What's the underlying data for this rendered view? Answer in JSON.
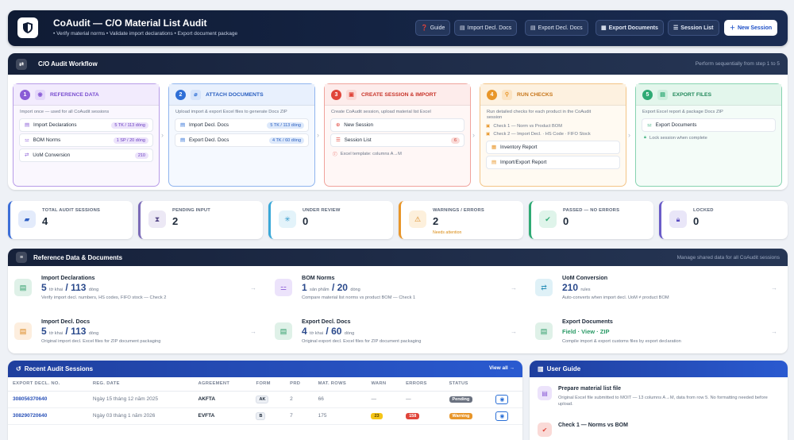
{
  "header": {
    "title": "CoAudit — C/O Material List Audit",
    "subtitle": "• Verify material norms  •  Validate import declarations  •  Export document package",
    "buttons": {
      "guide": "Guide",
      "import_docs": "Import Decl. Docs",
      "export_docs": "Export Decl. Docs",
      "export_documents": "Export Documents",
      "session_list": "Session List",
      "new_session": "New Session"
    }
  },
  "workflow": {
    "title": "C/O Audit Workflow",
    "note": "Perform sequentially from step 1 to 5",
    "steps": [
      {
        "num": "1",
        "title": "REFERENCE DATA",
        "desc": "Import once — used for all CoAudit sessions",
        "items": [
          {
            "label": "Import Declarations",
            "badge": "5 TK / 113 dòng"
          },
          {
            "label": "BOM Norms",
            "badge": "1 SP / 20 dòng"
          },
          {
            "label": "UoM Conversion",
            "badge": "210"
          }
        ]
      },
      {
        "num": "2",
        "title": "ATTACH DOCUMENTS",
        "desc": "Upload import & export Excel files to generate Docs ZIP",
        "items": [
          {
            "label": "Import Decl. Docs",
            "badge": "5 TK / 113 dòng"
          },
          {
            "label": "Export Decl. Docs",
            "badge": "4 TK / 60 dòng"
          }
        ]
      },
      {
        "num": "3",
        "title": "CREATE SESSION & IMPORT",
        "desc": "Create CoAudit session, upload material list Excel",
        "items": [
          {
            "label": "New Session",
            "badge": ""
          },
          {
            "label": "Session List",
            "badge": "6"
          }
        ],
        "note": "Excel template: columns A→M"
      },
      {
        "num": "4",
        "title": "RUN CHECKS",
        "desc": "Run detailed checks for each product in the CoAudit",
        "desc2": "session",
        "checks": [
          "Check 1 — Norm vs Product BOM",
          "Check 2 — Import Decl. · HS Code · FIFO Stock"
        ],
        "items": [
          {
            "label": "Inventory Report",
            "badge": ""
          },
          {
            "label": "Import/Export Report",
            "badge": ""
          }
        ]
      },
      {
        "num": "5",
        "title": "EXPORT FILES",
        "desc": "Export Excel report & package Docs ZIP",
        "items": [
          {
            "label": "Export Documents",
            "badge": ""
          }
        ],
        "note": "Lock session when complete"
      }
    ]
  },
  "stats": [
    {
      "label": "TOTAL AUDIT SESSIONS",
      "value": "4",
      "note": ""
    },
    {
      "label": "PENDING INPUT",
      "value": "2",
      "note": ""
    },
    {
      "label": "UNDER REVIEW",
      "value": "0",
      "note": ""
    },
    {
      "label": "WARNINGS / ERRORS",
      "value": "2",
      "note": "Needs attention"
    },
    {
      "label": "PASSED — NO ERRORS",
      "value": "0",
      "note": ""
    },
    {
      "label": "LOCKED",
      "value": "0",
      "note": ""
    }
  ],
  "reference": {
    "title": "Reference Data & Documents",
    "note": "Manage shared data for all CoAudit sessions",
    "cards": [
      {
        "title": "Import Declarations",
        "v1": "5",
        "u1": "tờ khai",
        "v2": "113",
        "u2": "dòng",
        "desc": "Verify import decl. numbers, HS codes, FIFO stock — Check 2"
      },
      {
        "title": "BOM Norms",
        "v1": "1",
        "u1": "sản phẩm",
        "v2": "20",
        "u2": "dòng",
        "desc": "Compare material list norms vs product BOM — Check 1"
      },
      {
        "title": "UoM Conversion",
        "v1": "210",
        "u1": "rules",
        "v2": "",
        "u2": "",
        "desc": "Auto-converts when import decl. UoM ≠ product BOM"
      },
      {
        "title": "Import Decl. Docs",
        "v1": "5",
        "u1": "tờ khai",
        "v2": "113",
        "u2": "dòng",
        "desc": "Original import decl. Excel files for ZIP document packaging"
      },
      {
        "title": "Export Decl. Docs",
        "v1": "4",
        "u1": "tờ khai",
        "v2": "60",
        "u2": "dòng",
        "desc": "Original export decl. Excel files for ZIP document packaging"
      },
      {
        "title": "Export Documents",
        "v1": "Field · View · ZIP",
        "u1": "",
        "v2": "",
        "u2": "",
        "desc": "Compile import & export customs files by export declaration"
      }
    ]
  },
  "sessions": {
    "title": "Recent Audit Sessions",
    "view_all": "View all →",
    "columns": [
      "EXPORT DECL. NO.",
      "REG. DATE",
      "AGREEMENT",
      "FORM",
      "PRD",
      "MAT. ROWS",
      "WARN",
      "ERRORS",
      "STATUS",
      ""
    ],
    "rows": [
      {
        "id": "308056370640",
        "date": "Ngày 15 tháng 12 năm 2025",
        "agreement": "AKFTA",
        "form": "AK",
        "prd": "2",
        "rows": "66",
        "warn": "—",
        "errors": "—",
        "status": "Pending"
      },
      {
        "id": "308290720640",
        "date": "Ngày 03 tháng 1 năm 2026",
        "agreement": "EVFTA",
        "form": "B",
        "prd": "7",
        "rows": "175",
        "warn": "23",
        "errors": "158",
        "status": "Warning"
      }
    ]
  },
  "guide": {
    "title": "User Guide",
    "items": [
      {
        "title": "Prepare material list file",
        "desc": "Original Excel file submitted to MOIT — 13 columns A→M, data from row 5. No formatting needed before upload."
      },
      {
        "title": "Check 1 — Norms vs BOM",
        "desc": ""
      }
    ]
  },
  "colors": {
    "step1": "#8a5cd6",
    "step2": "#2f6fd6",
    "step3": "#e0453a",
    "step4": "#e8962a",
    "step5": "#2faa74"
  }
}
